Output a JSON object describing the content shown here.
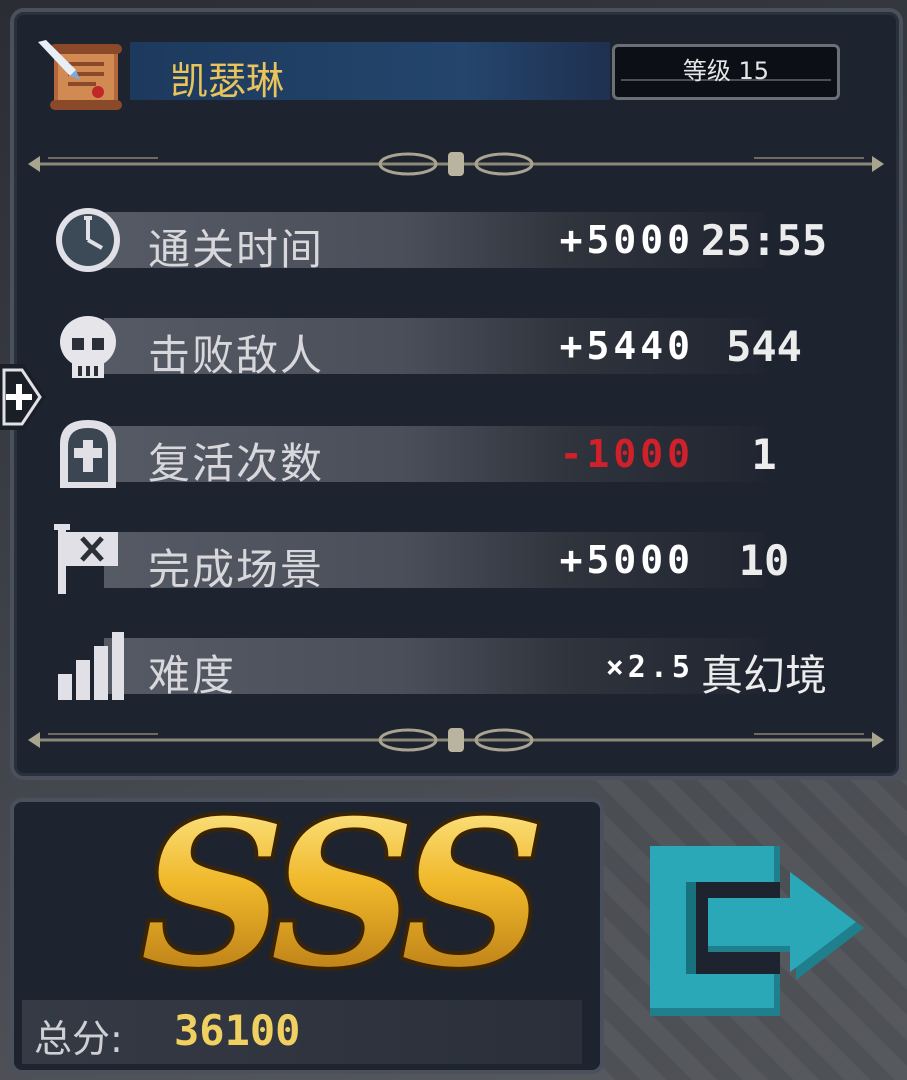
{
  "character": {
    "name": "凯瑟琳",
    "level_label": "等级 15"
  },
  "stats": [
    {
      "label": "通关时间",
      "score": "+5000",
      "value": "25:55",
      "icon": "clock-icon"
    },
    {
      "label": "击败敌人",
      "score": "+5440",
      "value": "544",
      "icon": "skull-icon"
    },
    {
      "label": "复活次数",
      "score": "-1000",
      "value": "1",
      "icon": "tombstone-icon"
    },
    {
      "label": "完成场景",
      "score": "+5000",
      "value": "10",
      "icon": "flag-icon"
    },
    {
      "label": "难度",
      "score": "×2.5",
      "value": "真幻境",
      "icon": "difficulty-bars-icon"
    }
  ],
  "result": {
    "grade": "SSS",
    "total_label": "总分:",
    "total_value": "36100"
  },
  "colors": {
    "gold": "#e8c45a",
    "negative": "#d0202a",
    "exit": "#2aa8b8"
  }
}
